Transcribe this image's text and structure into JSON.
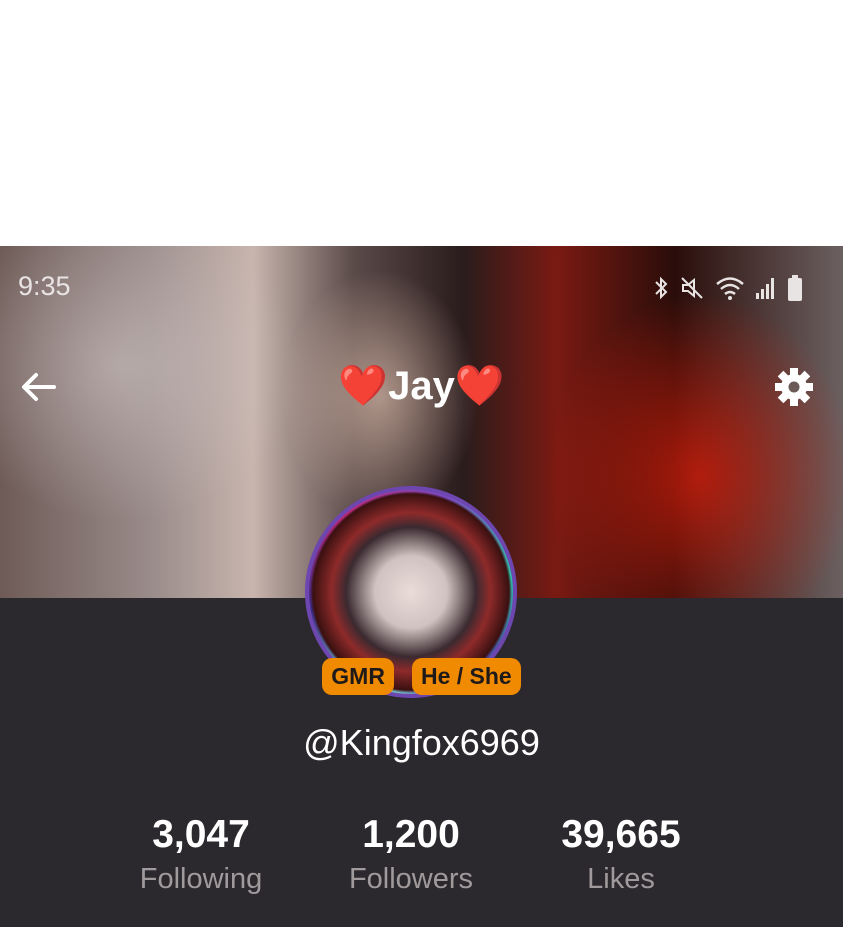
{
  "status_bar": {
    "time": "9:35"
  },
  "header": {
    "title": "❤️Jay❤️"
  },
  "profile": {
    "tags": [
      "GMR",
      "He / She"
    ],
    "username": "@Kingfox6969"
  },
  "stats": [
    {
      "value": "3,047",
      "label": "Following"
    },
    {
      "value": "1,200",
      "label": "Followers"
    },
    {
      "value": "39,665",
      "label": "Likes"
    }
  ],
  "icons": {
    "back": "arrow-left-icon",
    "settings": "gear-icon",
    "bluetooth": "bluetooth-icon",
    "mute": "mute-icon",
    "wifi": "wifi-icon",
    "signal": "signal-icon",
    "battery": "battery-icon"
  },
  "colors": {
    "page_background": "#2b292d",
    "tag_background": "#f08a00",
    "stat_label": "#a09a9c"
  }
}
